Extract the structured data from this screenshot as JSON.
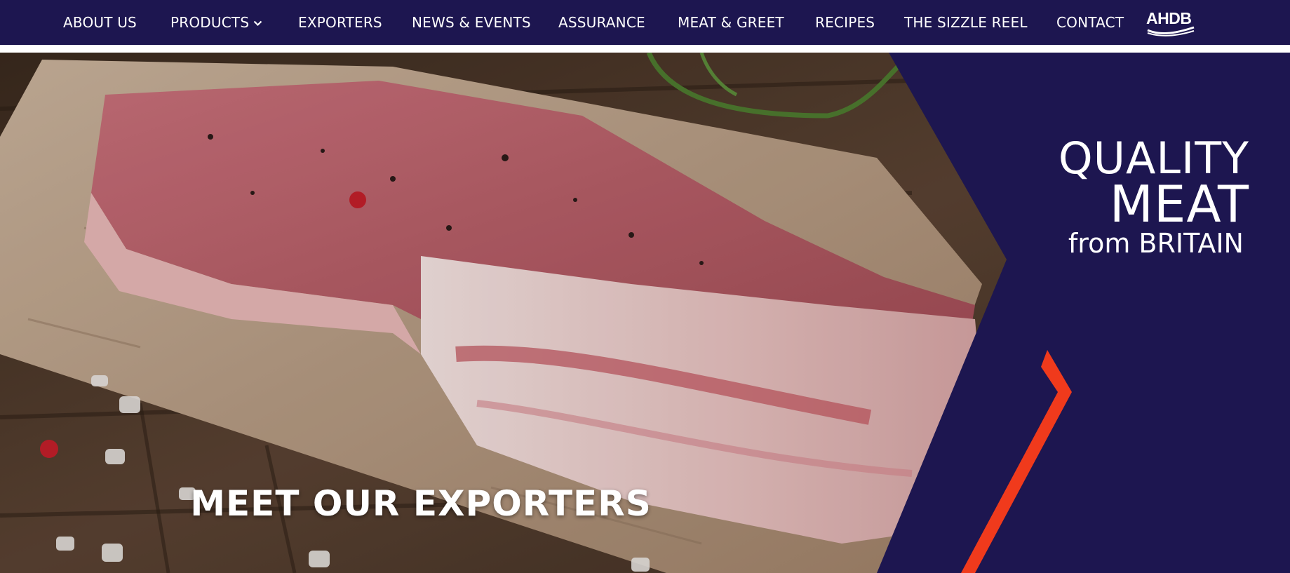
{
  "nav": {
    "items": [
      {
        "label": "ABOUT US"
      },
      {
        "label": "PRODUCTS"
      },
      {
        "label": "EXPORTERS"
      },
      {
        "label": "NEWS & EVENTS"
      },
      {
        "label": "ASSURANCE"
      },
      {
        "label": "MEAT & GREET"
      },
      {
        "label": "RECIPES"
      },
      {
        "label": "THE SIZZLE REEL"
      },
      {
        "label": "CONTACT"
      }
    ],
    "products_dropdown_icon": "chevron-down-icon",
    "partner_logo": "AHDB"
  },
  "hero": {
    "title": "MEET OUR EXPORTERS",
    "image": "raw-pork-chop-on-parchment-photo"
  },
  "brand_logo": {
    "line1": "QUALITY",
    "line2": "MEAT",
    "line3": "from BRITAIN"
  },
  "colors": {
    "navy": "#1d1650",
    "accent_red": "#f03a1c",
    "white": "#ffffff"
  }
}
